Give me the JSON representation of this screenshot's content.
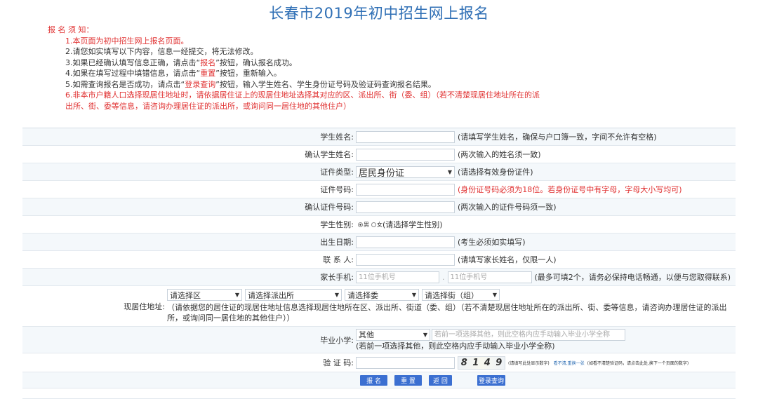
{
  "page_title": "长春市2019年初中招生网上报名",
  "notice": {
    "heading": "报 名 须 知：",
    "items": [
      "1.本页面为初中招生网上报名页面。",
      "2.请您如实填写以下内容，信息一经提交，将无法修改。",
      "3.如果已经确认填写信息正确，请点击“",
      "报名",
      "”按钮，确认报名成功。",
      "4.如果在填写过程中填错信息，请点击“",
      "重置",
      "”按钮，重新输入。",
      "5.如需查询报名是否成功，请点击“",
      "登录查询",
      "”按钮，输入学生姓名、学生身份证号码及验证码查询报名结果。",
      "6.非本市户籍人口选择现居住地址时，请依据居住证上的现居住地址选择其对应的区、派出所、街（委、组）（若不清楚现居住地址所在的派出所、街、委等信息，请咨询办理居住证的派出所，或询问同一居住地的其他住户）"
    ]
  },
  "form": {
    "student_name": {
      "label": "学生姓名:",
      "value": "",
      "hint": "(请填写学生姓名，确保与户口簿一致，字间不允许有空格)"
    },
    "confirm_name": {
      "label": "确认学生姓名:",
      "value": "",
      "hint": "(两次输入的姓名须一致)"
    },
    "id_type": {
      "label": "证件类型:",
      "selected": "居民身份证",
      "hint": "(请选择有效身份证件)"
    },
    "id_number": {
      "label": "证件号码:",
      "value": "",
      "hint": "(身份证号码必须为18位。若身份证号中有字母，字母大小写均可)"
    },
    "confirm_id": {
      "label": "确认证件号码:",
      "value": "",
      "hint": "(两次输入的证件号码须一致)"
    },
    "gender": {
      "label": "学生性别:",
      "male": "男",
      "female": "女",
      "hint": "(请选择学生性别)"
    },
    "birth": {
      "label": "出生日期:",
      "value": "",
      "hint": "(考生必须如实填写)"
    },
    "contact": {
      "label": "联 系 人:",
      "value": "",
      "hint": "(请填写家长姓名，仅限一人)"
    },
    "phone": {
      "label": "家长手机:",
      "placeholder1": "11位手机号",
      "placeholder2": "11位手机号",
      "hint": "(最多可填2个，请务必保持电话畅通，以便与您取得联系)"
    },
    "address": {
      "label": "现居住地址:",
      "selects": [
        "请选择区",
        "请选择派出所",
        "请选择委",
        "请选择街（组）"
      ],
      "note": "（请依据您的居住证的现居住地址信息选择现居住地所在区、派出所、街道（委、组）（若不清楚现居住地址所在的派出所、街、委等信息，请咨询办理居住证的派出所，或询问同一居住地的其他住户））"
    },
    "primary_school": {
      "label": "毕业小学:",
      "selected": "其他",
      "placeholder": "若前一项选择其他，则此空格内应手动输入毕业小学全称",
      "hint": "(若前一项选择其他，则此空格内应手动输入毕业小学全称)"
    },
    "captcha": {
      "label": "验 证 码:",
      "chars": [
        "8",
        "1",
        "4",
        "9"
      ],
      "note": "(请填写此处显示数字)",
      "refresh": "看不清,重换一张",
      "refresh_note": "(如看不清楚验证码，请点击此处,换下一个页面的数字)"
    }
  },
  "buttons": {
    "submit": "报 名",
    "reset": "重 置",
    "back": "返 回",
    "query": "登录查询"
  }
}
